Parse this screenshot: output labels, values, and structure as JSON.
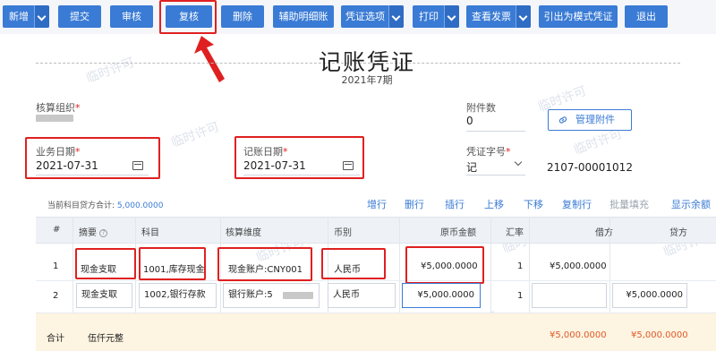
{
  "toolbar": {
    "new": "新增",
    "submit": "提交",
    "audit": "审核",
    "recheck": "复核",
    "delete": "删除",
    "aux_detail": "辅助明细账",
    "voucher_options": "凭证选项",
    "print": "打印",
    "view_invoice": "查看发票",
    "export_template": "引出为模式凭证",
    "exit": "退出"
  },
  "watermark": "临时许可",
  "header": {
    "title": "记账凭证",
    "period": "2021年7期"
  },
  "form": {
    "org_label": "核算组织",
    "business_date_label": "业务日期",
    "business_date": "2021-07-31",
    "posting_date_label": "记账日期",
    "posting_date": "2021-07-31",
    "attachments_label": "附件数",
    "attachments_value": "0",
    "manage_attachments": "管理附件",
    "voucher_word_label": "凭证字号",
    "voucher_word": "记",
    "voucher_number": "2107-00001012",
    "required_mark": "*"
  },
  "summary": {
    "label": "当前科目贷方合计:",
    "value": "5,000.0000"
  },
  "table_actions": [
    "增行",
    "删行",
    "插行",
    "上移",
    "下移",
    "复制行",
    "批量填充",
    "显示余额"
  ],
  "table": {
    "headers": {
      "index": "#",
      "summary": "摘要",
      "account": "科目",
      "dimension": "核算维度",
      "currency": "币别",
      "orig_amount": "原币金额",
      "rate": "汇率",
      "debit": "借方",
      "credit": "贷方"
    },
    "rows": [
      {
        "index": "1",
        "summary": "现金支取",
        "account": "1001,库存现金",
        "dimension": "现金账户:CNY001",
        "currency": "人民币",
        "orig_amount": "¥5,000.0000",
        "rate": "1",
        "debit": "¥5,000.0000",
        "credit": ""
      },
      {
        "index": "2",
        "summary": "现金支取",
        "account": "1002,银行存款",
        "dimension": "银行账户:5",
        "currency": "人民币",
        "orig_amount": "¥5,000.0000",
        "rate": "1",
        "debit": "",
        "credit": "¥5,000.0000"
      }
    ],
    "total": {
      "label": "合计",
      "words": "伍仟元整",
      "debit": "¥5,000.0000",
      "credit": "¥5,000.0000"
    }
  },
  "colors": {
    "primary": "#3a7bd5",
    "highlight_box": "#e02020",
    "total_row_bg": "#fdf4e1",
    "total_amount": "#e05a2a"
  },
  "icons": {
    "help": "question-circle-icon",
    "calendar": "calendar-icon",
    "link": "link-icon",
    "dropdown": "chevron-down-icon"
  }
}
